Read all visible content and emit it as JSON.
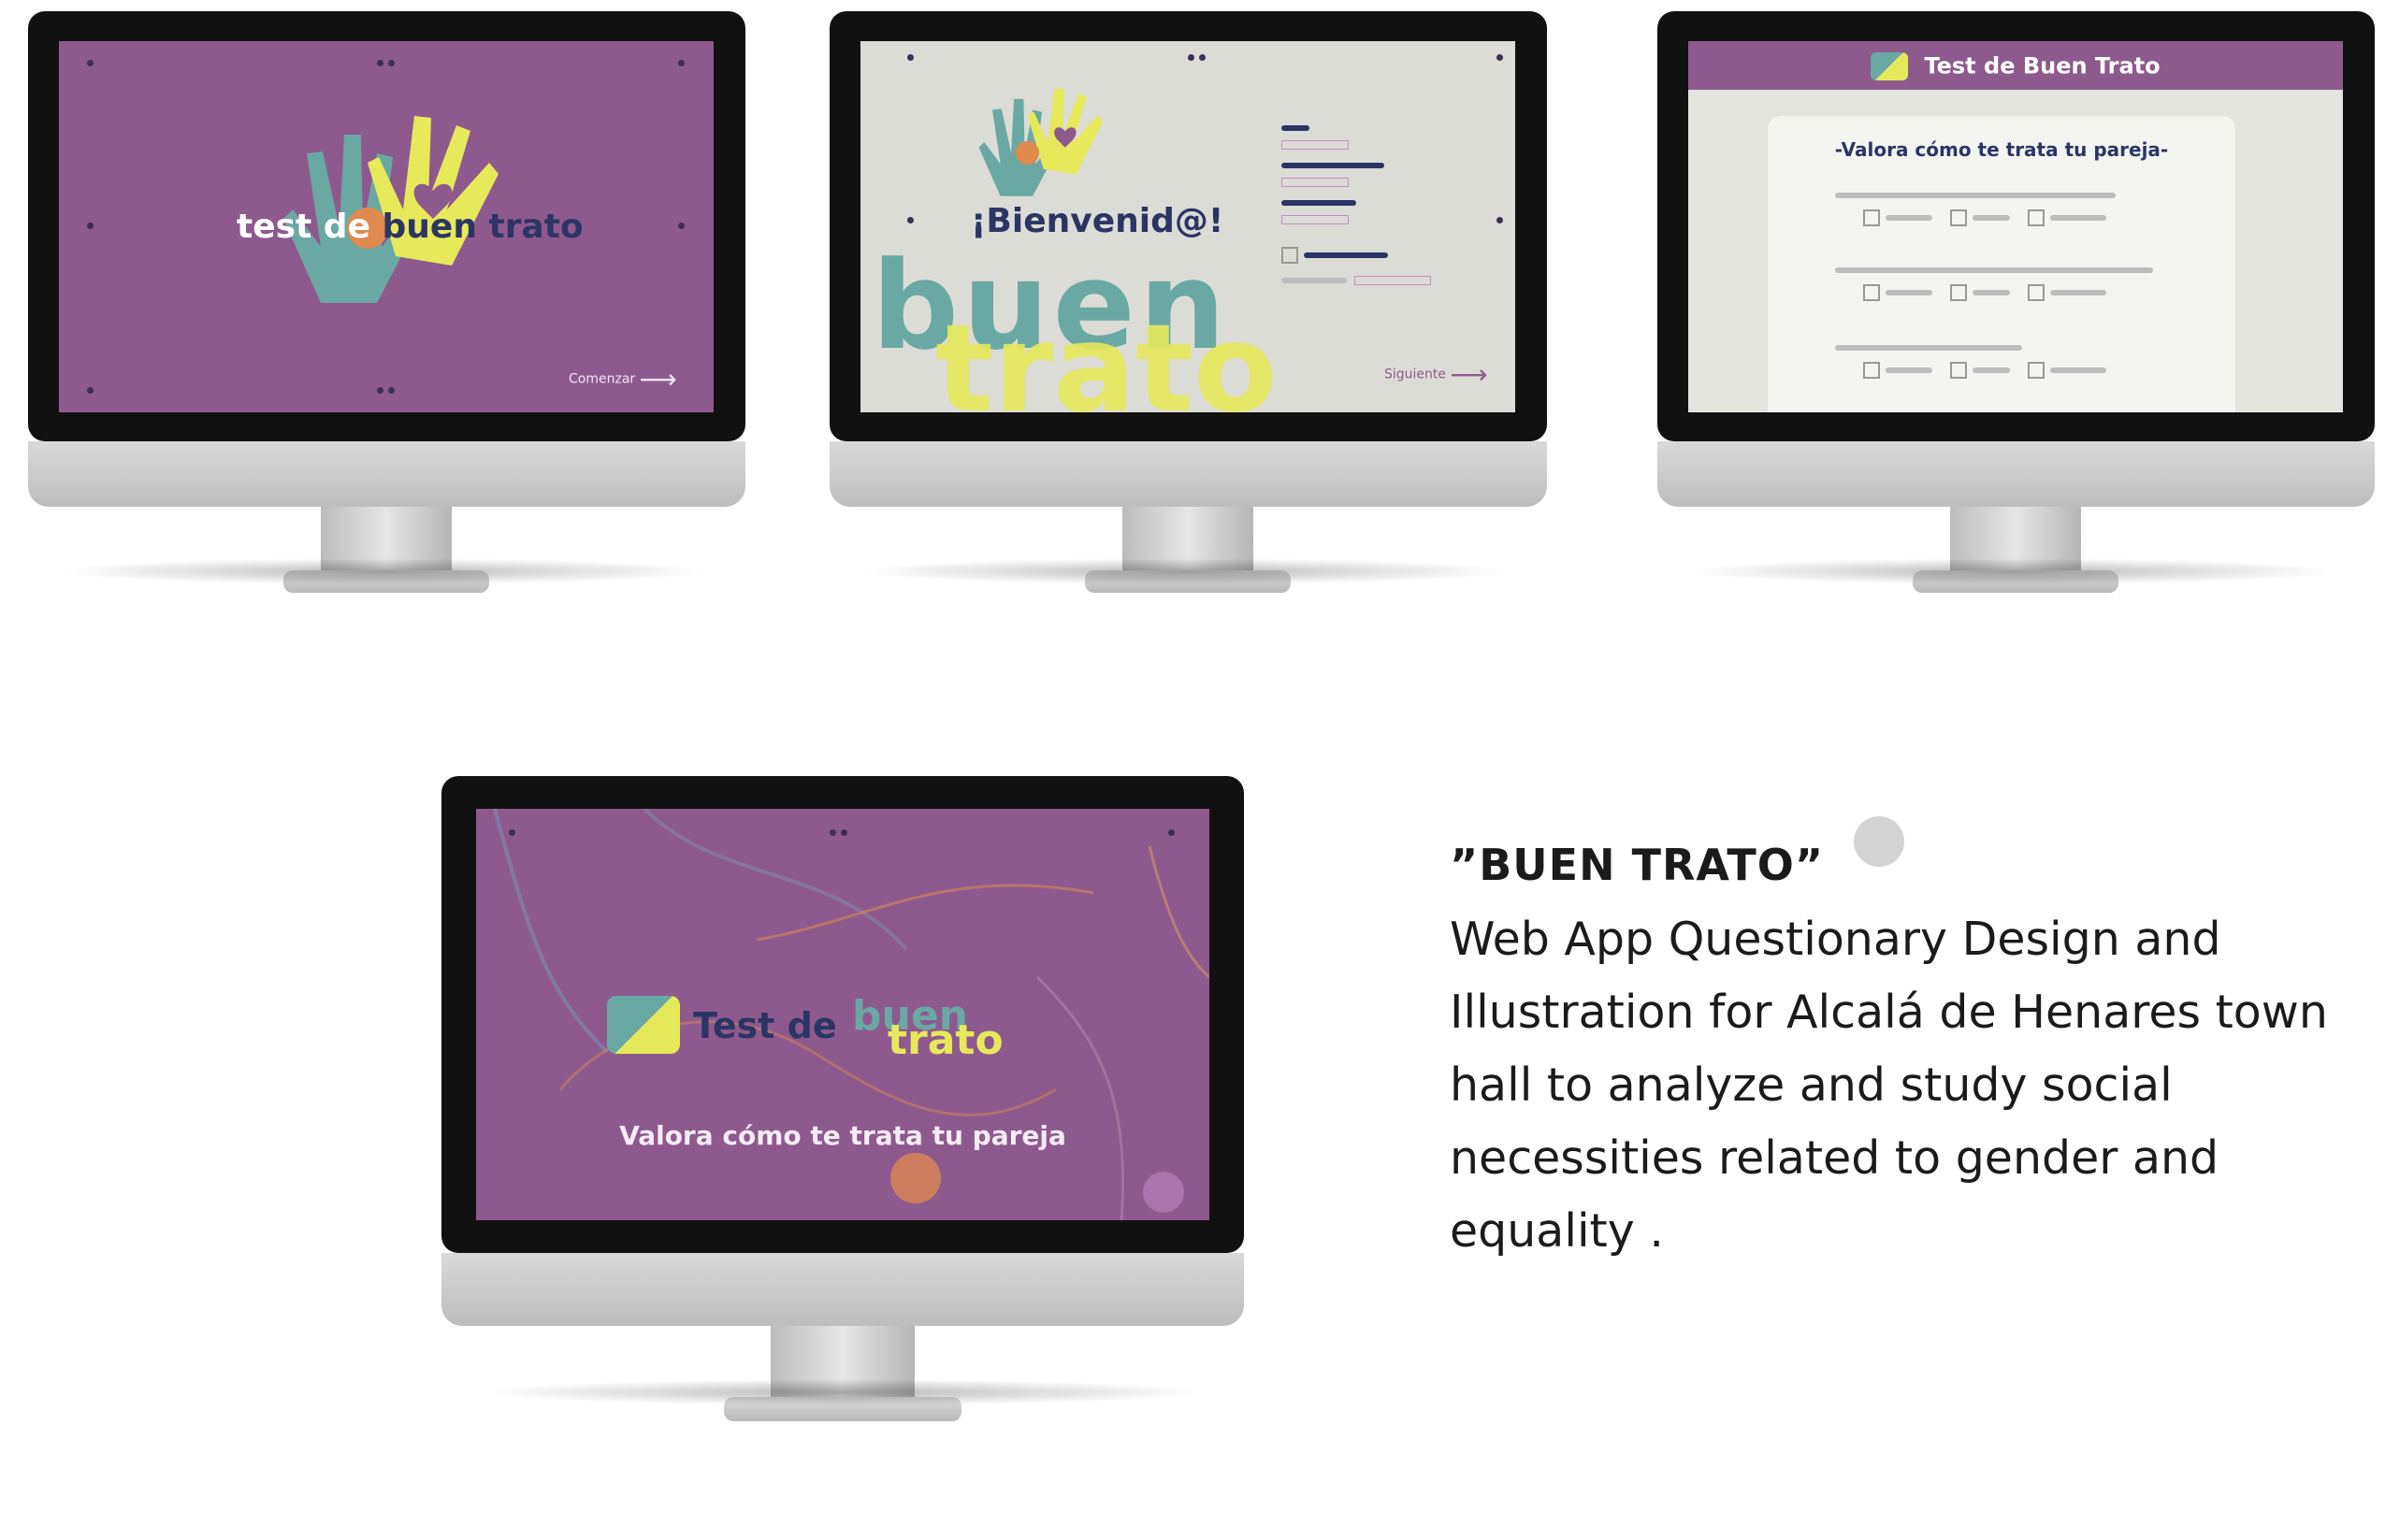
{
  "screens": {
    "s1": {
      "title_left": "test de",
      "title_right": "buen trato",
      "start_label": "Comenzar"
    },
    "s2": {
      "welcome": "¡Bienvenid@!",
      "big_word1": "buen",
      "big_word2": "trato",
      "next_label": "Siguiente"
    },
    "s3": {
      "header": "Test de Buen Trato",
      "question_title": "-Valora cómo te trata tu pareja-"
    },
    "s4": {
      "title_left": "Test de",
      "title_word1": "buen",
      "title_word2": "trato",
      "subtitle": "Valora cómo te trata tu pareja"
    }
  },
  "blurb": {
    "title": "”BUEN TRATO”",
    "description": "Web App Questionary Design  and Illustration for Alcalá de Henares town hall to analyze and study social necessities related to gender and equality ."
  },
  "colors": {
    "purple": "#8e5a8e",
    "teal": "#6aa9a3",
    "yellow": "#e6e95a",
    "navy": "#2b3565",
    "orange": "#e08a4e"
  }
}
